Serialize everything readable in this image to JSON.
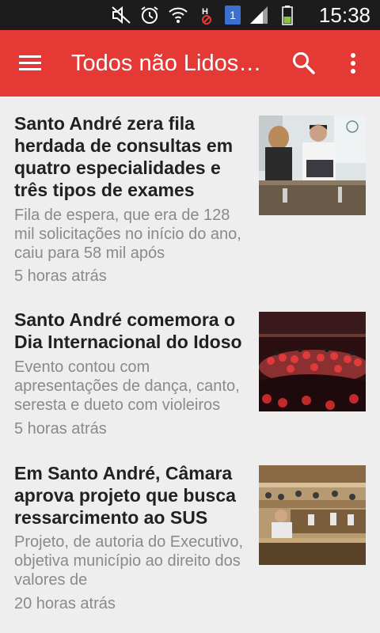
{
  "status_bar": {
    "time": "15:38",
    "sim_badge": "1",
    "icons": [
      "mute-icon",
      "alarm-icon",
      "wifi-icon",
      "h-network-icon",
      "sim-icon",
      "signal-icon",
      "battery-icon"
    ]
  },
  "app_bar": {
    "title": "Todos não Lidos…",
    "color": "#e53935",
    "icons": [
      "menu-icon",
      "search-icon",
      "more-vert-icon"
    ]
  },
  "articles": [
    {
      "headline": "Santo André zera fila herdada de consultas em quatro especialidades e três tipos de exames",
      "summary": "Fila de espera, que era de 128 mil solicitações no início do ano, caiu para 58 mil após",
      "time": "5 horas atrás"
    },
    {
      "headline": "Santo André comemora o Dia Internacional do Idoso",
      "summary": "Evento contou com apresentações de dança, canto, seresta e dueto com violeiros",
      "time": "5 horas atrás"
    },
    {
      "headline": "Em Santo André, Câmara aprova projeto que busca ressarcimento ao SUS",
      "summary": "Projeto, de autoria do Executivo, objetiva município ao direito dos valores de",
      "time": "20 horas atrás"
    }
  ]
}
